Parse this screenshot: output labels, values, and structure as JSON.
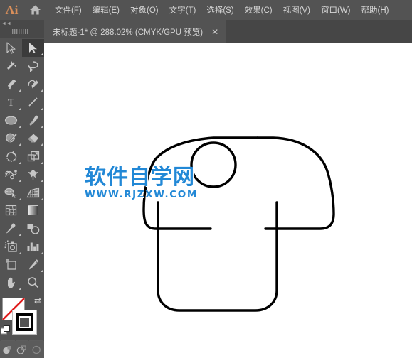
{
  "app": {
    "name": "Ai",
    "logo_color": "#d98f5a",
    "home_icon": "home-icon",
    "chrome_bg": "#535353",
    "tabbar_bg": "#464646"
  },
  "menubar": {
    "items": [
      {
        "label": "文件(F)",
        "name": "menu-file"
      },
      {
        "label": "编辑(E)",
        "name": "menu-edit"
      },
      {
        "label": "对象(O)",
        "name": "menu-object"
      },
      {
        "label": "文字(T)",
        "name": "menu-type"
      },
      {
        "label": "选择(S)",
        "name": "menu-select"
      },
      {
        "label": "效果(C)",
        "name": "menu-effect"
      },
      {
        "label": "视图(V)",
        "name": "menu-view"
      },
      {
        "label": "窗口(W)",
        "name": "menu-window"
      },
      {
        "label": "帮助(H)",
        "name": "menu-help"
      }
    ]
  },
  "tabbar": {
    "active_tab": {
      "title": "未标题-1* @ 288.02% (CMYK/GPU 预览)",
      "document_name": "未标题-1*",
      "zoom": "288.02%",
      "color_mode": "CMYK/GPU 预览",
      "close_label": "✕"
    }
  },
  "toolbar": {
    "grip_label": "▮▮▮▮▮▮",
    "corner_label": "◄◄",
    "tools": [
      {
        "name": "selection-tool",
        "icon": "arrow-cursor-icon",
        "active": false,
        "has_flyout": false
      },
      {
        "name": "direct-selection-tool",
        "icon": "filled-arrow-cursor-icon",
        "active": true,
        "has_flyout": true
      },
      {
        "name": "magic-wand-tool",
        "icon": "magic-wand-icon",
        "active": false,
        "has_flyout": false
      },
      {
        "name": "lasso-tool",
        "icon": "lasso-icon",
        "active": false,
        "has_flyout": false
      },
      {
        "name": "pen-tool",
        "icon": "pen-nib-icon",
        "active": false,
        "has_flyout": true
      },
      {
        "name": "curvature-tool",
        "icon": "curvature-icon",
        "active": false,
        "has_flyout": true
      },
      {
        "name": "type-tool",
        "icon": "type-T-icon",
        "active": false,
        "has_flyout": true
      },
      {
        "name": "line-segment-tool",
        "icon": "line-segment-icon",
        "active": false,
        "has_flyout": true
      },
      {
        "name": "ellipse-tool",
        "icon": "ellipse-icon",
        "active": false,
        "has_flyout": true
      },
      {
        "name": "paintbrush-tool",
        "icon": "paintbrush-icon",
        "active": false,
        "has_flyout": true
      },
      {
        "name": "shaper-tool",
        "icon": "shaper-pencil-icon",
        "active": false,
        "has_flyout": true
      },
      {
        "name": "eraser-tool",
        "icon": "eraser-icon",
        "active": false,
        "has_flyout": true
      },
      {
        "name": "rotate-tool",
        "icon": "rotate-icon",
        "active": false,
        "has_flyout": true
      },
      {
        "name": "scale-tool",
        "icon": "scale-icon",
        "active": false,
        "has_flyout": true
      },
      {
        "name": "width-tool",
        "icon": "width-warp-icon",
        "active": false,
        "has_flyout": true
      },
      {
        "name": "free-transform-tool",
        "icon": "pushpin-icon",
        "active": false,
        "has_flyout": true
      },
      {
        "name": "shape-builder-tool",
        "icon": "shape-builder-icon",
        "active": false,
        "has_flyout": true
      },
      {
        "name": "perspective-grid-tool",
        "icon": "perspective-grid-icon",
        "active": false,
        "has_flyout": true
      },
      {
        "name": "mesh-tool",
        "icon": "mesh-icon",
        "active": false,
        "has_flyout": false
      },
      {
        "name": "gradient-tool",
        "icon": "gradient-square-icon",
        "active": false,
        "has_flyout": false
      },
      {
        "name": "eyedropper-tool",
        "icon": "eyedropper-icon",
        "active": false,
        "has_flyout": true
      },
      {
        "name": "blend-tool",
        "icon": "blend-icon",
        "active": false,
        "has_flyout": false
      },
      {
        "name": "symbol-sprayer-tool",
        "icon": "symbol-sprayer-icon",
        "active": false,
        "has_flyout": true
      },
      {
        "name": "column-graph-tool",
        "icon": "bar-graph-icon",
        "active": false,
        "has_flyout": true
      },
      {
        "name": "artboard-tool",
        "icon": "artboard-icon",
        "active": false,
        "has_flyout": false
      },
      {
        "name": "slice-tool",
        "icon": "slice-knife-icon",
        "active": false,
        "has_flyout": true
      },
      {
        "name": "hand-tool",
        "icon": "hand-icon",
        "active": false,
        "has_flyout": true
      },
      {
        "name": "zoom-tool",
        "icon": "magnifier-icon",
        "active": false,
        "has_flyout": false
      }
    ],
    "fill_stroke": {
      "fill_name": "fill-swatch",
      "fill_color": "#ffffff",
      "fill_is_none": true,
      "stroke_name": "stroke-swatch",
      "stroke_color": "#000000",
      "swap_icon": "swap-fill-stroke-icon",
      "default_icon": "default-fill-stroke-icon"
    },
    "modes": [
      {
        "name": "color-mode-button",
        "icon": "solid-color-icon"
      },
      {
        "name": "gradient-mode-button",
        "icon": "gradient-icon"
      },
      {
        "name": "none-mode-button",
        "icon": "none-slash-icon"
      }
    ],
    "screen_modes": [
      {
        "name": "drawing-mode-normal",
        "icon": "draw-normal-icon"
      },
      {
        "name": "drawing-mode-behind",
        "icon": "draw-behind-icon"
      },
      {
        "name": "drawing-mode-inside",
        "icon": "draw-inside-icon"
      }
    ]
  },
  "canvas": {
    "background": "#ffffff",
    "artwork_name": "tshirt-outline-drawing",
    "stroke_color": "#000000",
    "watermark": {
      "chinese": "软件自学网",
      "url": "WWW.RJZXW.COM",
      "color": "#2288d6"
    }
  }
}
